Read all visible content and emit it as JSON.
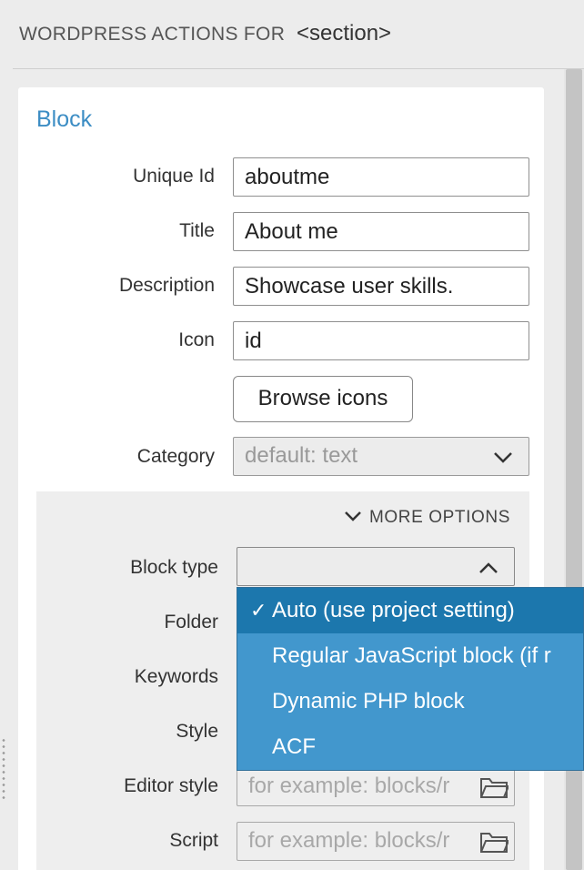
{
  "header": {
    "label": "WORDPRESS ACTIONS FOR",
    "element": "<section>"
  },
  "block": {
    "title": "Block",
    "fields": [
      {
        "label": "Unique Id",
        "value": "aboutme"
      },
      {
        "label": "Title",
        "value": "About me"
      },
      {
        "label": "Description",
        "value": "Showcase user skills."
      },
      {
        "label": "Icon",
        "value": "id"
      }
    ],
    "browse_icons_label": "Browse icons",
    "category": {
      "label": "Category",
      "value": "default: text"
    }
  },
  "more_options": {
    "toggle_label": "MORE OPTIONS",
    "block_type": {
      "label": "Block type",
      "value": ""
    },
    "folder": {
      "label": "Folder"
    },
    "keywords": {
      "label": "Keywords"
    },
    "style": {
      "label": "Style"
    },
    "editor_style": {
      "label": "Editor style",
      "placeholder": "for example: blocks/r"
    },
    "script": {
      "label": "Script",
      "placeholder": "for example: blocks/r"
    }
  },
  "block_type_menu": {
    "check_glyph": "✓",
    "options": [
      {
        "label": "Auto (use project setting)",
        "selected": true
      },
      {
        "label": "Regular JavaScript block (if r",
        "selected": false
      },
      {
        "label": "Dynamic PHP block",
        "selected": false
      },
      {
        "label": "ACF",
        "selected": false
      }
    ]
  },
  "colors": {
    "accent": "#3c8dc4",
    "menu_bg": "#4297cd",
    "menu_selected": "#1c77ad"
  },
  "icons": [
    "chevron-down-icon",
    "chevron-up-icon",
    "folder-icon",
    "checkmark-icon",
    "resize-grip-icon"
  ]
}
